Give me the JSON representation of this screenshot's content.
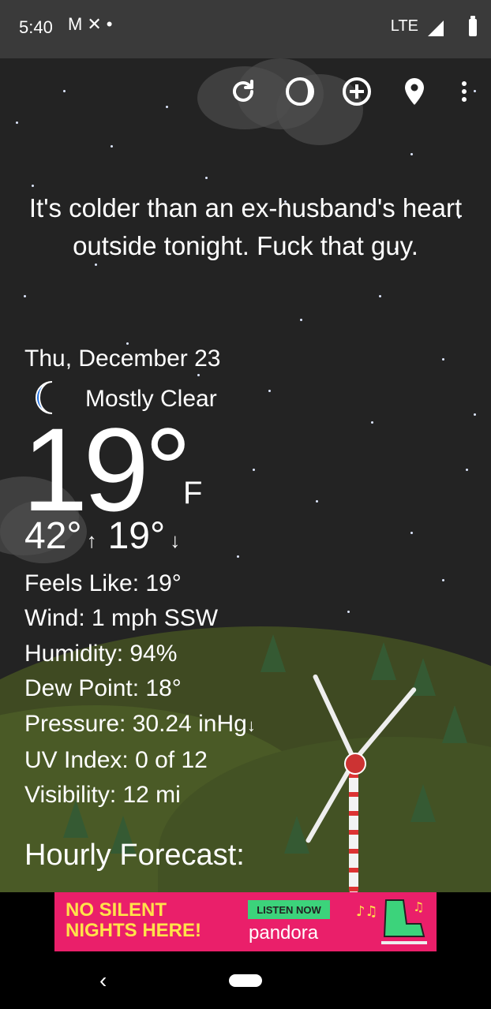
{
  "status_bar": {
    "time": "5:40",
    "icons_left": [
      "gmail-icon",
      "shuffle-icon",
      "dot-icon"
    ],
    "network": "LTE"
  },
  "toolbar": {
    "icons": [
      "refresh-icon",
      "theme-icon",
      "add-location-icon",
      "location-pin-icon",
      "more-vert-icon"
    ]
  },
  "quote": "It's colder than an ex-husband's heart outside tonight. Fuck that guy.",
  "weather": {
    "date": "Thu, December 23",
    "condition": "Mostly Clear",
    "condition_icon": "crescent-moon-icon",
    "temperature": "19°",
    "unit": "F",
    "high": "42°",
    "low": "19°"
  },
  "details": {
    "feels_like": "Feels Like:  19°",
    "wind": "Wind:  1 mph SSW",
    "humidity": "Humidity:  94%",
    "dew_point": "Dew Point:  18°",
    "pressure": "Pressure:  30.24 inHg",
    "uv_index": "UV Index:  0 of 12",
    "visibility": "Visibility:  12 mi"
  },
  "hourly_title": "Hourly Forecast:",
  "ad": {
    "line1": "NO SILENT",
    "line2": "NIGHTS HERE!",
    "cta": "LISTEN NOW",
    "brand": "pandora"
  },
  "colors": {
    "sky": "#232323",
    "status_bar": "#3a3a3a",
    "moon": "#1e6fe0",
    "ad_background": "#ea1f6a",
    "ad_text": "#ffe24a",
    "ad_cta": "#3cd37b"
  }
}
